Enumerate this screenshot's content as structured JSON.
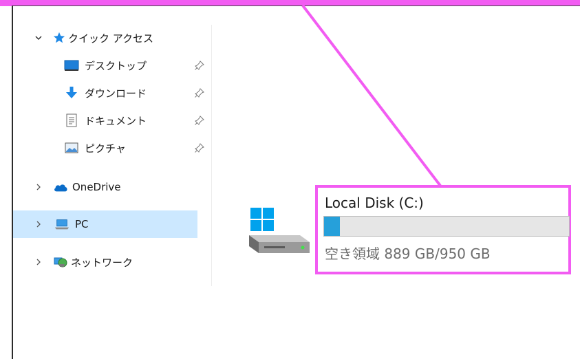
{
  "navigation": {
    "quick_access": {
      "label": "クイック アクセス",
      "items": [
        {
          "label": "デスクトップ",
          "icon": "desktop-icon"
        },
        {
          "label": "ダウンロード",
          "icon": "download-icon"
        },
        {
          "label": "ドキュメント",
          "icon": "document-icon"
        },
        {
          "label": "ピクチャ",
          "icon": "picture-icon"
        }
      ]
    },
    "onedrive": {
      "label": "OneDrive",
      "icon": "onedrive-icon"
    },
    "pc": {
      "label": "PC",
      "icon": "pc-icon",
      "selected": true
    },
    "network": {
      "label": "ネットワーク",
      "icon": "network-icon"
    }
  },
  "drive": {
    "name": "Local Disk (C:)",
    "space_text": "空き領域 889 GB/950 GB",
    "free_gb": 889,
    "total_gb": 950,
    "used_fraction": 0.064,
    "bar_color": "#26a0da",
    "icon": "hard-drive-windows-icon"
  },
  "annotation": {
    "color": "#f25cf2"
  }
}
